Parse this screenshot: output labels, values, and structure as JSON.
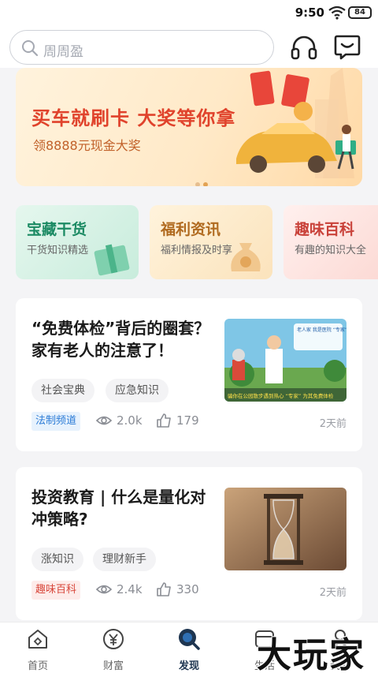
{
  "status_bar": {
    "time": "9:50",
    "battery": "84"
  },
  "header": {
    "search_placeholder": "周周盈",
    "icons": {
      "service": "headset-icon",
      "messages": "message-icon"
    }
  },
  "banner": {
    "headline": "买车就刷卡  大奖等你拿",
    "subline": "领8888元现金大奖",
    "page_count": 2,
    "active_page": 1
  },
  "categories": [
    {
      "title": "宝藏干货",
      "subtitle": "干货知识精选"
    },
    {
      "title": "福利资讯",
      "subtitle": "福利情报及时享"
    },
    {
      "title": "趣味百科",
      "subtitle": "有趣的知识大全"
    }
  ],
  "articles": [
    {
      "title": "“免费体检”背后的圈套？家有老人的注意了！",
      "tags": [
        "社会宝典",
        "应急知识"
      ],
      "channel": "法制频道",
      "views": "2.0k",
      "likes": "179",
      "time": "2天前",
      "thumb_caption_top": "老人家 我是医院 “专家” 可以为您免费体检",
      "thumb_caption_bottom": "骗你在公园散步遇到热心 “专家” 为其免费体检"
    },
    {
      "title": "投资教育 | 什么是量化对冲策略?",
      "tags": [
        "涨知识",
        "理财新手"
      ],
      "channel": "趣味百科",
      "views": "2.4k",
      "likes": "330",
      "time": "2天前"
    }
  ],
  "tabs": [
    {
      "label": "首页",
      "icon": "home-icon",
      "active": false
    },
    {
      "label": "财富",
      "icon": "wealth-icon",
      "active": false
    },
    {
      "label": "发现",
      "icon": "discover-icon",
      "active": true
    },
    {
      "label": "生活",
      "icon": "life-icon",
      "active": false
    },
    {
      "label": "我的",
      "icon": "profile-icon",
      "active": false
    }
  ],
  "watermark": "大玩家",
  "colors": {
    "accent_red": "#e0432c",
    "tab_active": "#1e3550",
    "green": "#1b8a63"
  }
}
